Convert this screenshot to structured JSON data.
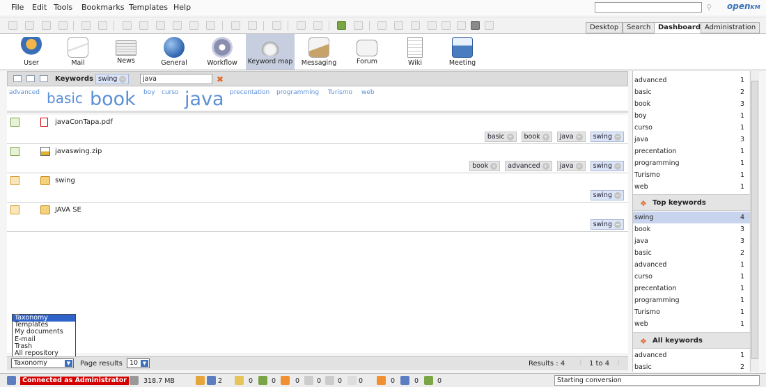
{
  "menu": [
    "File",
    "Edit",
    "Tools",
    "Bookmarks",
    "Templates",
    "Help"
  ],
  "logo": {
    "text": "openKM",
    "main": "open",
    "sub": "KM"
  },
  "workspace_tabs": [
    "Desktop",
    "Search",
    "Dashboard",
    "Administration"
  ],
  "active_workspace_tab": "Dashboard",
  "dashboard": [
    {
      "label": "User",
      "icon": "user-icon",
      "color": "#e9a53a"
    },
    {
      "label": "Mail",
      "icon": "mail-icon",
      "color": "#d8d8d8"
    },
    {
      "label": "News",
      "icon": "news-icon",
      "color": "#cfcfcf"
    },
    {
      "label": "General",
      "icon": "globe-icon",
      "color": "#3e79c4"
    },
    {
      "label": "Workflow",
      "icon": "gear-icon",
      "color": "#8a8fb0"
    },
    {
      "label": "Keyword map",
      "icon": "cloud-icon",
      "color": "#b7b7b7"
    },
    {
      "label": "Messaging",
      "icon": "messaging-icon",
      "color": "#c7a36a"
    },
    {
      "label": "Forum",
      "icon": "forum-icon",
      "color": "#dcdcdc"
    },
    {
      "label": "Wiki",
      "icon": "wiki-icon",
      "color": "#e2e2e2"
    },
    {
      "label": "Meeting",
      "icon": "meeting-icon",
      "color": "#4a7cc0"
    }
  ],
  "active_dashboard": "Keyword map",
  "keywords_panel": {
    "title": "Keywords",
    "selected_tag": "swing",
    "input_value": "java"
  },
  "cloud": [
    "advanced",
    "basic",
    "book",
    "boy",
    "curso",
    "java",
    "precentation",
    "programming",
    "Turismo",
    "web"
  ],
  "results": [
    {
      "name": "javaConTapa.pdf",
      "type": "pdf-icon",
      "tags": [
        "basic",
        "book",
        "java",
        "swing"
      ]
    },
    {
      "name": "javaswing.zip",
      "type": "zip-icon",
      "tags": [
        "book",
        "advanced",
        "java",
        "swing"
      ]
    },
    {
      "name": "swing",
      "type": "folder-icon",
      "tags": [
        "swing"
      ]
    },
    {
      "name": "JAVA SE",
      "type": "folder-icon",
      "tags": [
        "swing"
      ]
    }
  ],
  "context_options": [
    "Taxonomy",
    "Templates",
    "My documents",
    "E-mail",
    "Trash",
    "All repository"
  ],
  "context_selected": "Taxonomy",
  "page_results_label": "Page results",
  "page_results_value": "10",
  "results_summary": "Results : 4",
  "pagination": "1 to 4",
  "right_panel": {
    "keywords": [
      {
        "k": "advanced",
        "c": "1"
      },
      {
        "k": "basic",
        "c": "2"
      },
      {
        "k": "book",
        "c": "3"
      },
      {
        "k": "boy",
        "c": "1"
      },
      {
        "k": "curso",
        "c": "1"
      },
      {
        "k": "java",
        "c": "3"
      },
      {
        "k": "precentation",
        "c": "1"
      },
      {
        "k": "programming",
        "c": "1"
      },
      {
        "k": "Turismo",
        "c": "1"
      },
      {
        "k": "web",
        "c": "1"
      }
    ],
    "top_title": "Top keywords",
    "top_keywords": [
      {
        "k": "swing",
        "c": "4"
      },
      {
        "k": "book",
        "c": "3"
      },
      {
        "k": "java",
        "c": "3"
      },
      {
        "k": "basic",
        "c": "2"
      },
      {
        "k": "advanced",
        "c": "1"
      },
      {
        "k": "curso",
        "c": "1"
      },
      {
        "k": "precentation",
        "c": "1"
      },
      {
        "k": "programming",
        "c": "1"
      },
      {
        "k": "Turismo",
        "c": "1"
      },
      {
        "k": "web",
        "c": "1"
      }
    ],
    "all_title": "All keywords",
    "all_keywords": [
      {
        "k": "advanced",
        "c": "1"
      },
      {
        "k": "basic",
        "c": "2"
      }
    ]
  },
  "status": {
    "connection": "Connected as Administrator",
    "memory": "318.7 MB",
    "users": "2",
    "counters": [
      "0",
      "0",
      "0",
      "0",
      "0",
      "0",
      "0",
      "0",
      "0",
      "0"
    ],
    "conversion": "Starting conversion"
  }
}
